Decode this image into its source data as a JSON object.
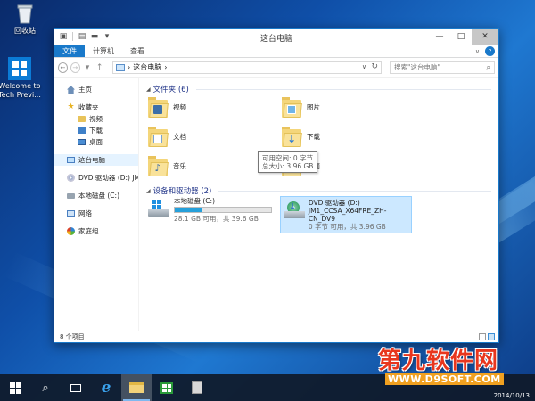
{
  "desktop": {
    "icons": [
      {
        "label": "回收站"
      },
      {
        "label": "Welcome to Tech Previ..."
      }
    ]
  },
  "window": {
    "title": "这台电脑",
    "tabs": [
      "文件",
      "计算机",
      "查看"
    ],
    "help": "?",
    "address": {
      "path_item": "这台电脑"
    },
    "search": {
      "placeholder": "搜索\"这台电脑\""
    },
    "status": "8 个项目"
  },
  "sidebar": {
    "items": [
      {
        "label": "主页",
        "icon": "home-icon"
      },
      {
        "label": "收藏夹",
        "icon": "star-icon"
      },
      {
        "label": "视频",
        "icon": "folder-icon"
      },
      {
        "label": "下载",
        "icon": "download-folder-icon"
      },
      {
        "label": "桌面",
        "icon": "desktop-icon"
      },
      {
        "label": "这台电脑",
        "icon": "pc-icon"
      },
      {
        "label": "DVD 驱动器 (D:) JM",
        "icon": "dvd-icon"
      },
      {
        "label": "本地磁盘 (C:)",
        "icon": "disk-icon"
      },
      {
        "label": "网络",
        "icon": "network-icon"
      },
      {
        "label": "家庭组",
        "icon": "homegroup-icon"
      }
    ]
  },
  "content": {
    "folders_header": "文件夹 (6)",
    "folders": [
      {
        "name": "视频"
      },
      {
        "name": "图片"
      },
      {
        "name": "文档"
      },
      {
        "name": "下载"
      },
      {
        "name": "音乐"
      },
      {
        "name": "桌面"
      }
    ],
    "devices_header": "设备和驱动器 (2)",
    "drives": [
      {
        "name": "本地磁盘 (C:)",
        "free_text": "28.1 GB 可用，共 39.6 GB",
        "used_fraction": 0.29
      },
      {
        "name": "DVD 驱动器 (D:)",
        "label": "JM1_CCSA_X64FRE_ZH-CN_DV9",
        "free_text": "0 字节 可用，共 3.96 GB"
      }
    ],
    "tooltip": {
      "line1": "可用空间: 0 字节",
      "line2": "总大小: 3.96 GB"
    }
  },
  "taskbar": {
    "buttons": [
      "start-button",
      "search-button",
      "ie-button",
      "file-explorer-button",
      "store-button",
      "document-button"
    ]
  },
  "clock": {
    "date": "2014/10/13"
  },
  "watermark": {
    "title": "第九软件网",
    "url": "WWW.D9SOFT.COM"
  }
}
